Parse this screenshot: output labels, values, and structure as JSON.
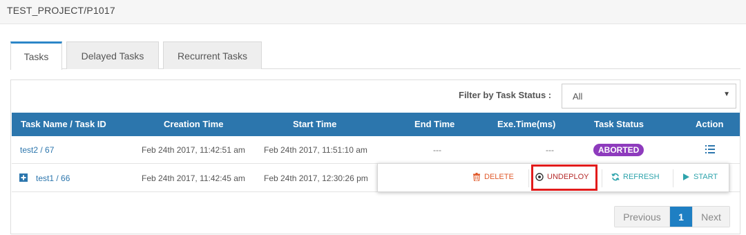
{
  "header": {
    "path": "TEST_PROJECT/P1017"
  },
  "tabs": [
    {
      "label": "Tasks",
      "active": true
    },
    {
      "label": "Delayed Tasks",
      "active": false
    },
    {
      "label": "Recurrent Tasks",
      "active": false
    }
  ],
  "filter": {
    "label": "Filter by Task Status :",
    "value": "All"
  },
  "table": {
    "headers": [
      "Task Name / Task ID",
      "Creation Time",
      "Start Time",
      "End Time",
      "Exe.Time(ms)",
      "Task Status",
      "Action"
    ],
    "rows": [
      {
        "name": "test2 / 67",
        "creation": "Feb 24th 2017, 11:42:51 am",
        "start": "Feb 24th 2017, 11:51:10 am",
        "end": "---",
        "exe": "---",
        "status": "ABORTED"
      },
      {
        "name": "test1 / 66",
        "creation": "Feb 24th 2017, 11:42:45 am",
        "start": "Feb 24th 2017, 12:30:26 pm"
      }
    ]
  },
  "actions": {
    "delete": "DELETE",
    "undeploy": "UNDEPLOY",
    "refresh": "REFRESH",
    "start": "START"
  },
  "pagination": {
    "previous": "Previous",
    "current": "1",
    "next": "Next"
  },
  "colors": {
    "accent": "#2c76ad",
    "aborted": "#8e3bbd",
    "highlight": "#e21b1b",
    "delete": "#e05a2b",
    "refresh": "#2fa4ac"
  }
}
